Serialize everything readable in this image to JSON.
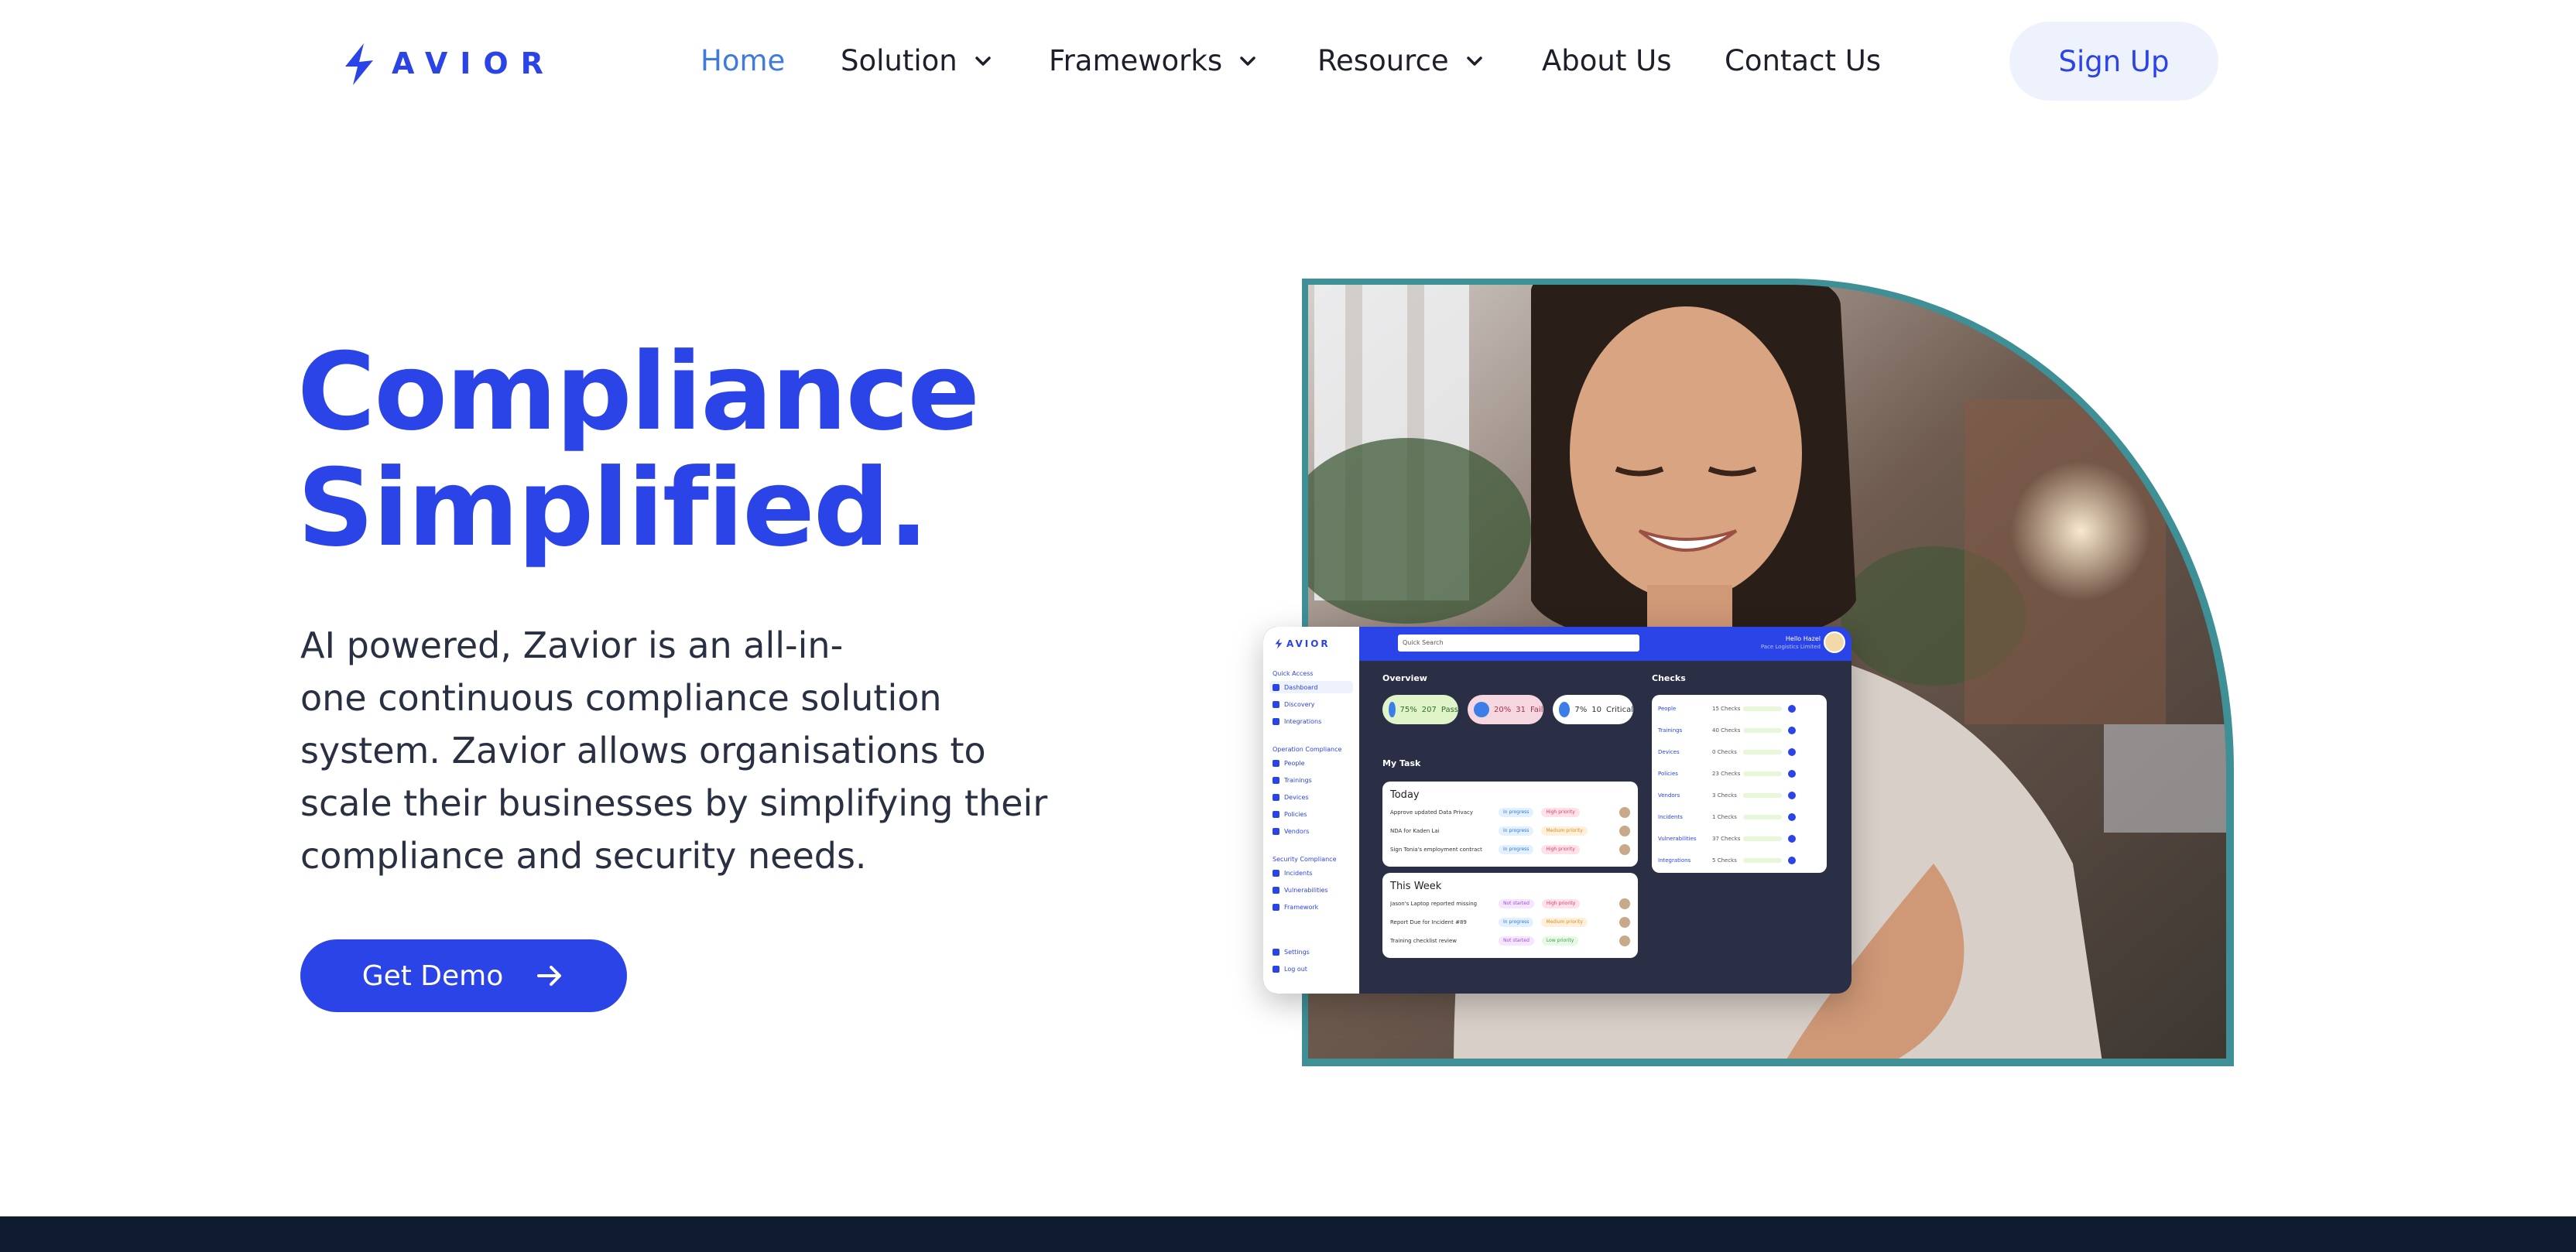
{
  "nav": {
    "logo_text": "AVIOR",
    "links": [
      {
        "label": "Home",
        "active": true
      },
      {
        "label": "Solution",
        "dropdown": true
      },
      {
        "label": "Frameworks",
        "dropdown": true
      },
      {
        "label": "Resource",
        "dropdown": true
      },
      {
        "label": "About Us"
      },
      {
        "label": "Contact Us"
      }
    ],
    "signup_label": "Sign Up"
  },
  "hero": {
    "headline_line1": "Compliance",
    "headline_line2": "Simplified.",
    "subtext_lines": [
      "AI powered, Zavior is an all-in-",
      "one continuous compliance solution",
      "system. Zavior allows organisations to",
      "scale their businesses by simplifying their",
      "compliance and security needs."
    ],
    "cta_label": "Get Demo"
  },
  "dashboard": {
    "logo_text": "AVIOR",
    "search_placeholder": "Quick Search",
    "user_name": "Hello Hazel",
    "user_company": "Pace Logistics Limited",
    "sidebar": {
      "quick_access": "Quick Access",
      "quick_items": [
        "Dashboard",
        "Discovery",
        "Integrations"
      ],
      "operation": "Operation Compliance",
      "operation_items": [
        "People",
        "Trainings",
        "Devices",
        "Policies",
        "Vendors"
      ],
      "security": "Security Compliance",
      "security_items": [
        "Incidents",
        "Vulnerabilities",
        "Framework"
      ],
      "bottom_items": [
        "Settings",
        "Log out"
      ]
    },
    "overview_label": "Overview",
    "overview_pills": [
      {
        "pct": "75%",
        "count": "207",
        "label": "Pass"
      },
      {
        "pct": "20%",
        "count": "31",
        "label": "Fail"
      },
      {
        "pct": "7%",
        "count": "10",
        "label": "Critical"
      }
    ],
    "my_task_label": "My Task",
    "today_label": "Today",
    "today_tasks": [
      {
        "name": "Approve updated Data Privacy",
        "status": "In progress",
        "priority": "High priority"
      },
      {
        "name": "NDA for Kaden Lai",
        "status": "In progress",
        "priority": "Medium priority"
      },
      {
        "name": "Sign Tonia's employment contract",
        "status": "In progress",
        "priority": "High priority"
      }
    ],
    "week_label": "This Week",
    "week_tasks": [
      {
        "name": "Jason's Laptop reported missing",
        "status": "Not started",
        "priority": "High priority"
      },
      {
        "name": "Report Due for Incident #89",
        "status": "In progress",
        "priority": "Medium priority"
      },
      {
        "name": "Training checklist review",
        "status": "Not started",
        "priority": "Low priority"
      }
    ],
    "checks_label": "Checks",
    "checks": [
      {
        "name": "People",
        "count": "15",
        "unit": "Checks"
      },
      {
        "name": "Trainings",
        "count": "40",
        "unit": "Checks"
      },
      {
        "name": "Devices",
        "count": "0",
        "unit": "Checks"
      },
      {
        "name": "Policies",
        "count": "23",
        "unit": "Checks"
      },
      {
        "name": "Vendors",
        "count": "3",
        "unit": "Checks"
      },
      {
        "name": "Incidents",
        "count": "1",
        "unit": "Checks"
      },
      {
        "name": "Vulnerabilities",
        "count": "37",
        "unit": "Checks"
      },
      {
        "name": "Integrations",
        "count": "5",
        "unit": "Checks"
      }
    ]
  },
  "colors": {
    "brand_blue": "#2b44e8",
    "active_nav": "#3f7ae0",
    "signup_bg": "#eef2fd",
    "frame_teal": "#3f8f96",
    "footer_navy": "#0e1a2e"
  }
}
